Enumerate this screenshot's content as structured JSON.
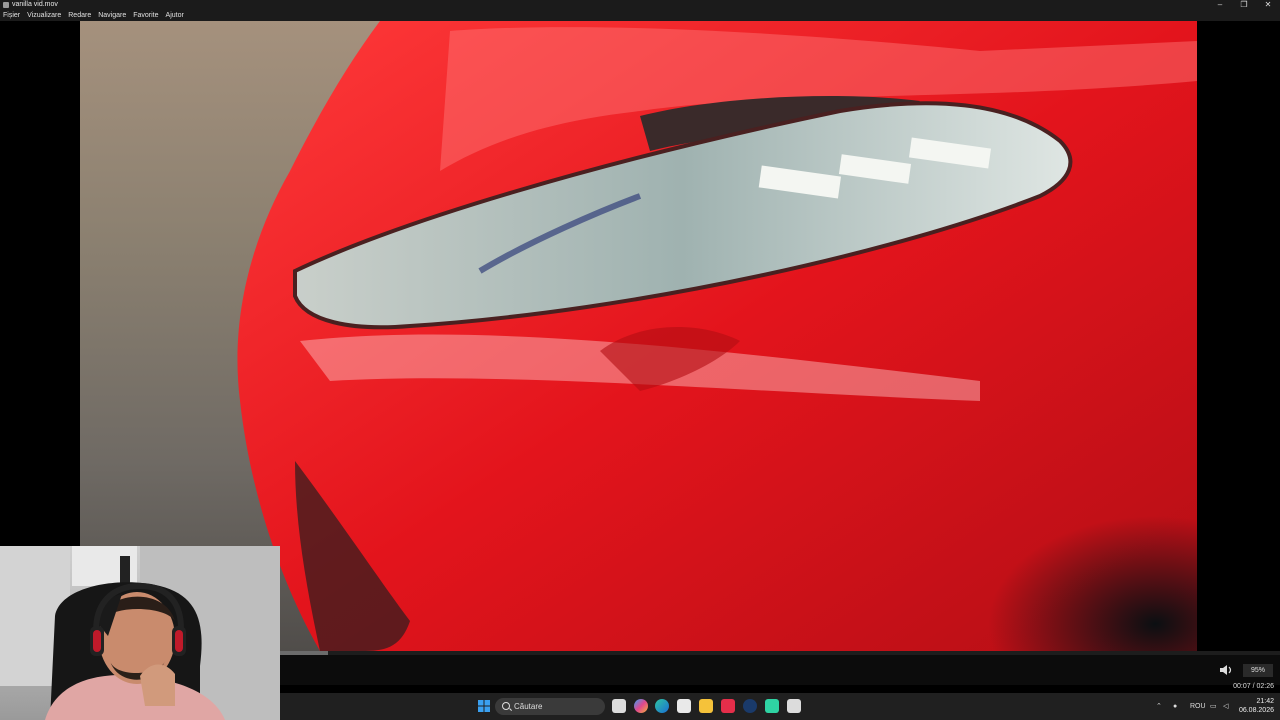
{
  "window": {
    "title": "vanilla vid.mov",
    "controls": [
      "–",
      "❐",
      "✕"
    ]
  },
  "menu": [
    "Fișier",
    "Vizualizare",
    "Redare",
    "Navigare",
    "Favorite",
    "Ajutor"
  ],
  "player": {
    "volume": "95%",
    "time": "00:07 / 02:26",
    "progress_fraction": 0.048
  },
  "taskbar": {
    "search_label": "Căutare",
    "language": "ROU",
    "clock_time": "21:42",
    "clock_date": "06.08.2026",
    "pinned_icons": [
      "start-icon",
      "task-view-icon",
      "copilot-icon",
      "edge-icon",
      "store-icon",
      "file-explorer-icon",
      "app-red-icon",
      "steam-icon",
      "app-green-icon",
      "media-player-icon"
    ]
  },
  "colors": {
    "car_red": "#e3141c",
    "taskbar_bg": "#202020",
    "chrome_bg": "#1b1b1b"
  }
}
